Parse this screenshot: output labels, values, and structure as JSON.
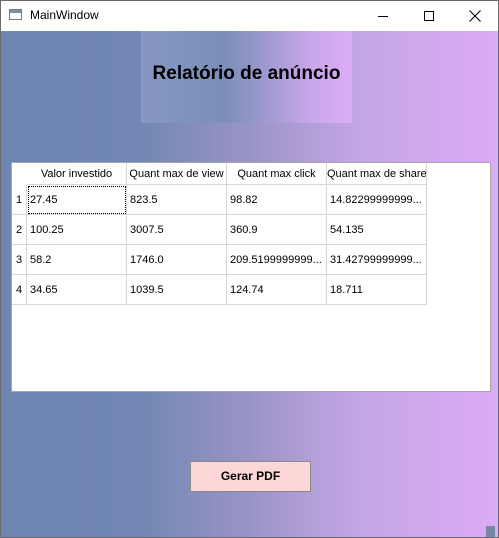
{
  "window": {
    "title": "MainWindow"
  },
  "header": {
    "title": "Relatório de anúncio"
  },
  "table": {
    "columns": [
      "Valor investido",
      "Quant max de view",
      "Quant max click",
      "Quant max de share"
    ],
    "row_labels": [
      "1",
      "2",
      "3",
      "4"
    ],
    "rows": [
      [
        "27.45",
        "823.5",
        "98.82",
        "14.82299999999..."
      ],
      [
        "100.25",
        "3007.5",
        "360.9",
        "54.135"
      ],
      [
        "58.2",
        "1746.0",
        "209.5199999999...",
        "31.42799999999..."
      ],
      [
        "34.65",
        "1039.5",
        "124.74",
        "18.711"
      ]
    ]
  },
  "actions": {
    "generate_pdf_label": "Gerar PDF"
  },
  "colors": {
    "button_bg": "#fdd7d7",
    "gradient_left": "#6f86b2",
    "gradient_right": "#dcaaf6"
  }
}
